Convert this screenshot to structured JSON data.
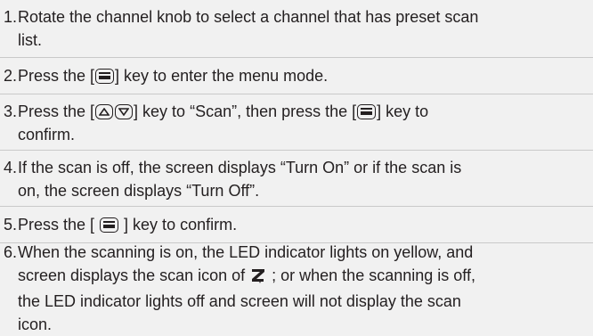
{
  "steps": [
    {
      "number": "1.",
      "lines": [
        {
          "before": "Rotate the channel knob to select a channel that has preset scan"
        },
        {
          "before": "list."
        }
      ]
    },
    {
      "number": "2.",
      "lines": [
        {
          "before": "Press the [",
          "icon": "menu-key-icon",
          "after": "] key to enter the menu mode."
        }
      ]
    },
    {
      "number": "3.",
      "lines": [
        {
          "before": "Press the [",
          "icon": "up-down-key-icon",
          "after": "] key to “Scan”, then press the [",
          "icon2": "menu-key-icon",
          "after2": "] key to"
        },
        {
          "before": "confirm."
        }
      ]
    },
    {
      "number": "4.",
      "lines": [
        {
          "before": "If the scan is off, the screen displays “Turn On” or if the scan is"
        },
        {
          "before": "on, the screen displays “Turn Off”."
        }
      ]
    },
    {
      "number": "5.",
      "lines": [
        {
          "before": "Press the [ ",
          "icon": "menu-key-icon",
          "after": " ] key to confirm."
        }
      ]
    },
    {
      "number": "6.",
      "lines": [
        {
          "before": "When the scanning is on, the LED indicator lights on yellow, and"
        },
        {
          "before": "screen displays the scan icon of ",
          "icon": "scan-icon",
          "after": " ; or when the scanning is off,"
        },
        {
          "before": "the LED indicator lights off and screen will not display the scan"
        },
        {
          "before": "icon."
        }
      ]
    }
  ]
}
